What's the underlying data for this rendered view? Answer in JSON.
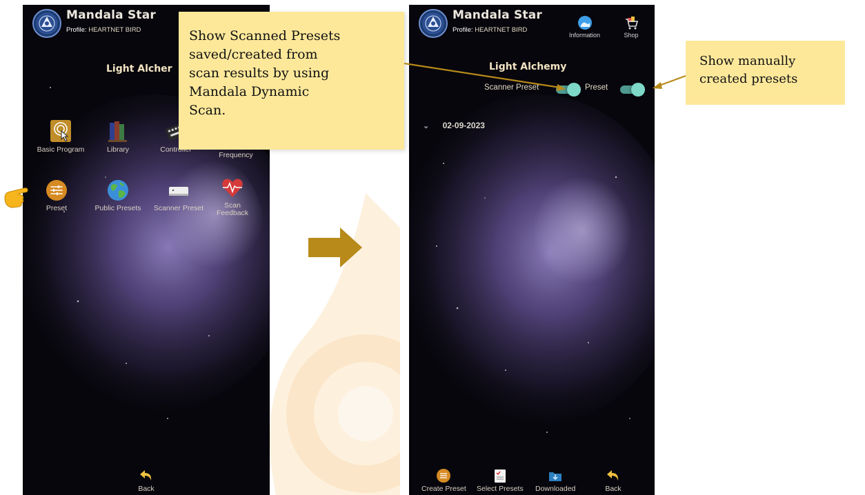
{
  "colors": {
    "callout_bg": "#fde89a",
    "arrow": "#b8860b",
    "toggle_on": "#7ed8c8",
    "title_gold": "#f2e4c2"
  },
  "phone1": {
    "app_title": "Mandala Star",
    "profile_label": "Profile:",
    "profile_value": "HEARTNET BIRD",
    "page_title": "Light Alcher",
    "grid": [
      {
        "label": "Basic Program",
        "icon": "touch-icon"
      },
      {
        "label": "Library",
        "icon": "books-icon"
      },
      {
        "label": "Controller",
        "icon": "keyboard-icon"
      },
      {
        "label": "Frequency",
        "icon": "frequency-icon"
      },
      {
        "label": "Preset",
        "icon": "sliders-icon"
      },
      {
        "label": "Public Presets",
        "icon": "globe-icon"
      },
      {
        "label": "Scanner Preset",
        "icon": "scanner-icon"
      },
      {
        "label": "Scan",
        "label2": "Feedback",
        "icon": "heart-scan-icon"
      }
    ],
    "back_label": "Back"
  },
  "phone2": {
    "app_title": "Mandala Star",
    "profile_label": "Profile:",
    "profile_value": "HEARTNET BIRD",
    "information_label": "Information",
    "shop_label": "Shop",
    "page_title": "Light Alchemy",
    "scanner_toggle_label": "Scanner Preset",
    "preset_toggle_label": "Preset",
    "date": "02-09-2023",
    "bottom": [
      {
        "label": "Create Preset",
        "icon": "sliders-icon"
      },
      {
        "label": "Select Presets",
        "icon": "checklist-icon"
      },
      {
        "label": "Downloaded",
        "icon": "download-folder-icon"
      },
      {
        "label": "Back",
        "icon": "back-arrow-icon"
      }
    ]
  },
  "callouts": {
    "scanned": [
      "Show Scanned Presets",
      "saved/created from",
      "scan results by using",
      "Mandala Dynamic",
      "Scan."
    ],
    "manual": [
      "Show manually",
      "created presets"
    ]
  }
}
